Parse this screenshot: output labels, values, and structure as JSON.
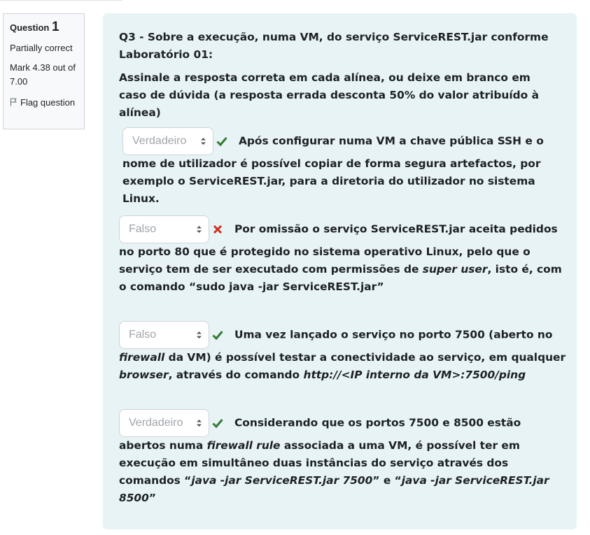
{
  "question_info": {
    "label": "Question",
    "number": "1",
    "state": "Partially correct",
    "grade": "Mark 4.38 out of 7.00",
    "flag_label": "Flag question",
    "flag_icon": "flag-outline-icon"
  },
  "question": {
    "title": "Q3 - Sobre a execução, numa VM, do serviço ServiceREST.jar conforme Laboratório 01:",
    "instructions": "Assinale a resposta correta em cada alínea, ou deixe em branco em caso de dúvida (a resposta errada desconta 50% do valor atribuído à alínea)"
  },
  "colors": {
    "correct": "#357a32",
    "incorrect": "#ca3120",
    "panel": "#e7f3f5"
  },
  "items": [
    {
      "selected": "Verdadeiro",
      "result": "correct",
      "text_1": "Após configurar numa VM a chave pública SSH e o nome de utilizador é possível copiar de forma segura artefactos, por exemplo o ServiceREST.jar, para a diretoria do utilizador no sistema Linux."
    },
    {
      "selected": "Falso",
      "result": "incorrect",
      "text_1": "Por omissão o serviço ServiceREST.jar aceita pedidos no porto 80 que é protegido no sistema operativo Linux, pelo que  o serviço tem de ser executado com permissões de ",
      "em_1": "super user",
      "text_2": ", isto é, com o comando “sudo java -jar ServiceREST.jar”"
    },
    {
      "selected": "Falso",
      "result": "correct",
      "text_1": "Uma vez lançado o serviço no porto 7500 (aberto no ",
      "em_1": "firewall",
      "text_2": " da VM) é possível testar a conectividade ao serviço, em qualquer ",
      "em_2": "browser",
      "text_3": ", através do comando ",
      "em_3": "http://<IP interno da VM>:7500/ping"
    },
    {
      "selected": "Verdadeiro",
      "result": "correct",
      "text_1": "Considerando que os portos 7500 e 8500 estão abertos numa ",
      "em_1": "firewall rule",
      "text_2": " associada a uma VM, é possível ter em execução em simultâneo duas instâncias do serviço através dos comandos “",
      "em_2": "java -jar ServiceREST.jar 7500",
      "text_3": "” e “",
      "em_3": "java -jar ServiceREST.jar 8500",
      "text_4": "”"
    }
  ]
}
